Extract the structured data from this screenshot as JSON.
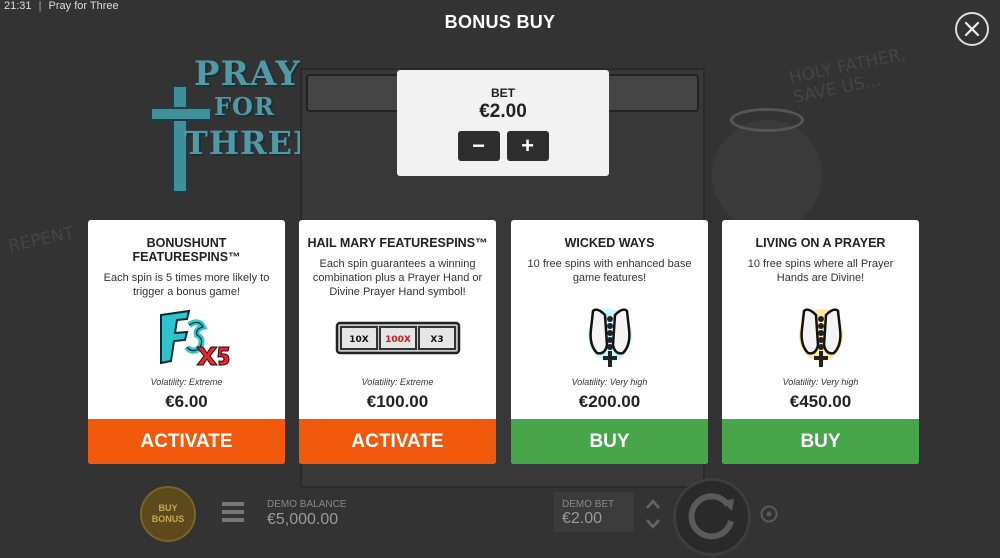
{
  "status_bar": {
    "time": "21:31",
    "separator": "|",
    "app_name": "Pray for Three"
  },
  "dialog": {
    "title": "BONUS BUY",
    "close_icon": "close-icon"
  },
  "background": {
    "logo": {
      "line1": "PRAY",
      "line2": "FOR",
      "line3": "THREE"
    },
    "scribble_right": "HOLY FATHER, SAVE US...",
    "scribble_left": "REPENT"
  },
  "bet": {
    "label": "BET",
    "value": "€2.00",
    "minus": "−",
    "plus": "+"
  },
  "cards": [
    {
      "title": "BONUSHUNT FEATURESPINS™",
      "description": "Each spin is 5 times more likely to trigger a bonus game!",
      "icon": "fs-x5-icon",
      "volatility": "Volatility: Extreme",
      "price": "€6.00",
      "button": "ACTIVATE",
      "button_color": "#f15a0c"
    },
    {
      "title": "HAIL MARY FEATURESPINS™",
      "description": "Each spin guarantees a winning combination plus a Prayer Hand or Divine Prayer Hand symbol!",
      "icon": "multiplier-reel-icon",
      "reel_labels": [
        "10X",
        "100X",
        "X3"
      ],
      "volatility": "Volatility: Extreme",
      "price": "€100.00",
      "button": "ACTIVATE",
      "button_color": "#f15a0c"
    },
    {
      "title": "WICKED WAYS",
      "description": "10 free spins with enhanced base game features!",
      "icon": "prayer-hands-cyan-icon",
      "volatility": "Volatility: Very high",
      "price": "€200.00",
      "button": "BUY",
      "button_color": "#47a54a"
    },
    {
      "title": "LIVING ON A PRAYER",
      "description": "10 free spins where all Prayer Hands are Divine!",
      "icon": "prayer-hands-gold-icon",
      "volatility": "Volatility: Very high",
      "price": "€450.00",
      "button": "BUY",
      "button_color": "#47a54a"
    }
  ],
  "bottom_bar": {
    "buy_bonus_line1": "BUY",
    "buy_bonus_line2": "BONUS",
    "balance_label": "DEMO BALANCE",
    "balance_value": "€5,000.00",
    "bet_label": "DEMO BET",
    "bet_value": "€2.00"
  }
}
